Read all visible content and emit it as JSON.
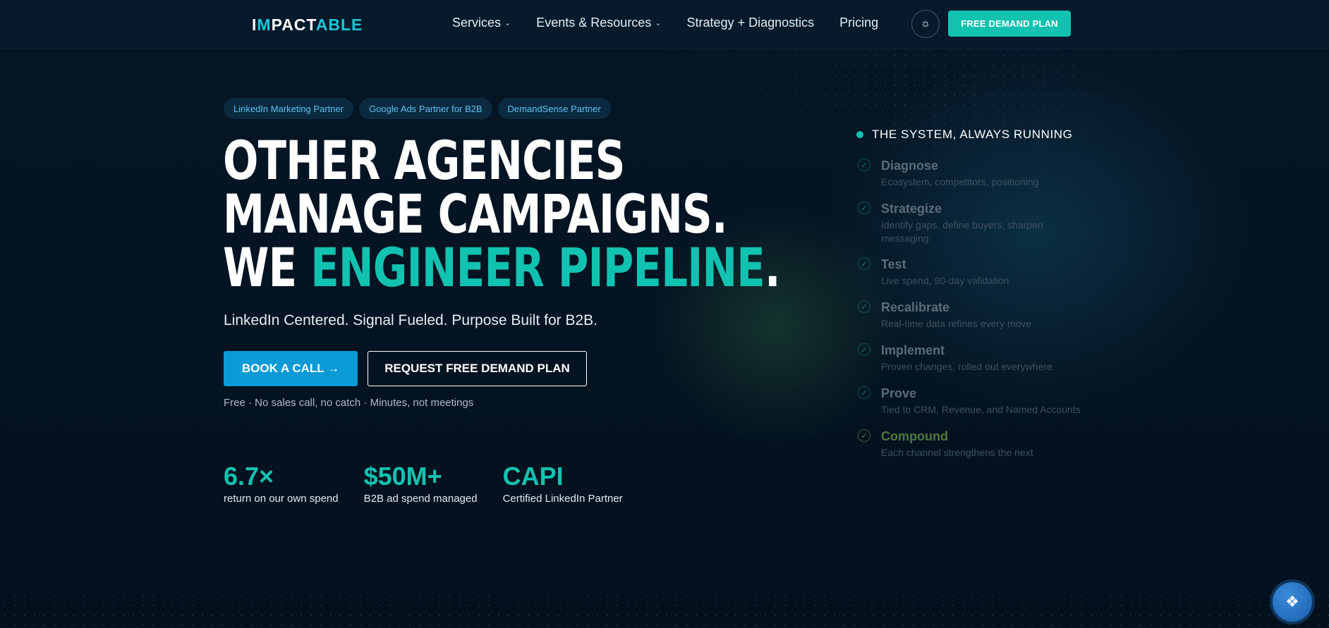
{
  "header": {
    "logo_prefix": "I",
    "logo_mark": "M",
    "logo_main": "PACT",
    "logo_accent": "ABLE",
    "nav": [
      {
        "label": "Services",
        "has_dropdown": true
      },
      {
        "label": "Events & Resources",
        "has_dropdown": true
      },
      {
        "label": "Strategy + Diagnostics",
        "has_dropdown": false
      },
      {
        "label": "Pricing",
        "has_dropdown": false
      }
    ],
    "theme_icon": "sun-icon",
    "cta_label": "FREE DEMAND PLAN"
  },
  "badges": [
    "LinkedIn Marketing Partner",
    "Google Ads Partner for B2B",
    "DemandSense Partner"
  ],
  "hero": {
    "line1": "OTHER AGENCIES",
    "line2": "MANAGE CAMPAIGNS.",
    "line3_start": "WE ",
    "line3_accent": "ENGINEER PIPELINE",
    "line3_end": ".",
    "subtitle": "LinkedIn Centered. Signal Fueled. Purpose Built for B2B.",
    "primary_cta": "BOOK A CALL →",
    "secondary_cta": "REQUEST FREE DEMAND PLAN",
    "fineprint": "Free · No sales call, no catch · Minutes, not meetings"
  },
  "stats": [
    {
      "value": "6.7×",
      "label": "return on our own spend"
    },
    {
      "value": "$50M+",
      "label": "B2B ad spend managed"
    },
    {
      "value": "CAPI",
      "label": "Certified LinkedIn Partner"
    }
  ],
  "system": {
    "title": "THE SYSTEM, ALWAYS RUNNING",
    "steps": [
      {
        "title": "Diagnose",
        "desc": "Ecosystem, competitors, positioning"
      },
      {
        "title": "Strategize",
        "desc": "Identify gaps, define buyers, sharpen messaging"
      },
      {
        "title": "Test",
        "desc": "Live spend, 90-day validation"
      },
      {
        "title": "Recalibrate",
        "desc": "Real-time data refines every move"
      },
      {
        "title": "Implement",
        "desc": "Proven changes, rolled out everywhere"
      },
      {
        "title": "Prove",
        "desc": "Tied to CRM, Revenue, and Named Accounts"
      },
      {
        "title": "Compound",
        "desc": "Each channel strengthens the next"
      }
    ]
  },
  "colors": {
    "accent_teal": "#12c2b0",
    "primary_blue": "#0a9bd6",
    "background": "#04121f"
  },
  "widget_icon": "chat-support-icon"
}
